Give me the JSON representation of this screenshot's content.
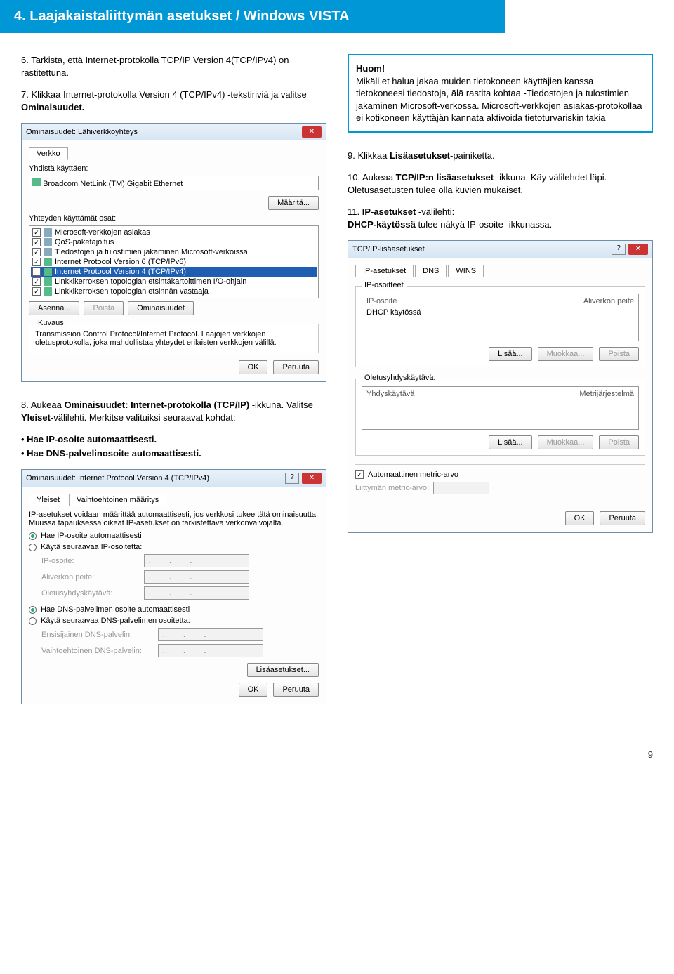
{
  "section_title": "4. Laajakaistaliittymän asetukset / Windows VISTA",
  "page_number": "9",
  "left": {
    "step6": {
      "text": "6. Tarkista, että Internet-protokolla TCP/IP Version 4(TCP/IPv4) on rastitettuna."
    },
    "step7": {
      "text_a": "7. Klikkaa Internet-protokolla Version 4 (TCP/IPv4) -tekstiriviä  ja valitse ",
      "text_b": "Ominaisuudet."
    },
    "win1": {
      "title": "Ominaisuudet: Lähiverkkoyhteys",
      "tab": "Verkko",
      "connect_using_label": "Yhdistä käyttäen:",
      "adapter": "Broadcom NetLink (TM) Gigabit Ethernet",
      "btn_maaritä": "Määritä...",
      "items_label": "Yhteyden käyttämät osat:",
      "items": [
        {
          "label": "Microsoft-verkkojen asiakas",
          "checked": true
        },
        {
          "label": "QoS-paketajoitus",
          "checked": true
        },
        {
          "label": "Tiedostojen ja tulostimien jakaminen Microsoft-verkoissa",
          "checked": true
        },
        {
          "label": "Internet Protocol Version 6 (TCP/IPv6)",
          "checked": true
        },
        {
          "label": "Internet Protocol Version 4 (TCP/IPv4)",
          "checked": true,
          "selected": true
        },
        {
          "label": "Linkkikerroksen topologian etsintäkartoittimen I/O-ohjain",
          "checked": true
        },
        {
          "label": "Linkkikerroksen topologian etsinnän vastaaja",
          "checked": true
        }
      ],
      "btn_asenna": "Asenna...",
      "btn_poista": "Poista",
      "btn_ominaisuudet": "Ominaisuudet",
      "desc_label": "Kuvaus",
      "desc_text": "Transmission Control Protocol/Internet Protocol. Laajojen verkkojen oletusprotokolla, joka mahdollistaa yhteydet erilaisten verkkojen välillä.",
      "ok": "OK",
      "cancel": "Peruuta"
    },
    "step8": {
      "text_a": "8. Aukeaa ",
      "text_b": "Ominaisuudet: Internet-protokolla (TCP/IP)",
      "text_c": " -ikkuna. Valitse ",
      "text_d": "Yleiset",
      "text_e": "-välilehti. Merkitse valituiksi seuraavat kohdat:",
      "bul1": "Hae IP-osoite automaattisesti.",
      "bul2": "Hae DNS-palvelinosoite automaattisesti."
    },
    "win2": {
      "title": "Ominaisuudet: Internet Protocol Version 4 (TCP/IPv4)",
      "tab_general": "Yleiset",
      "tab_alt": "Vaihtoehtoinen määritys",
      "intro": "IP-asetukset voidaan määrittää automaattisesti, jos verkkosi tukee tätä ominaisuutta. Muussa tapauksessa oikeat IP-asetukset on tarkistettava verkonvalvojalta.",
      "r1": "Hae IP-osoite automaattisesti",
      "r2": "Käytä seuraavaa IP-osoitetta:",
      "f_ip": "IP-osoite:",
      "f_mask": "Aliverkon peite:",
      "f_gw": "Oletusyhdyskäytävä:",
      "r3": "Hae DNS-palvelimen osoite automaattisesti",
      "r4": "Käytä seuraavaa DNS-palvelimen osoitetta:",
      "f_dns1": "Ensisijainen DNS-palvelin:",
      "f_dns2": "Vaihtoehtoinen DNS-palvelin:",
      "btn_adv": "Lisäasetukset...",
      "ok": "OK",
      "cancel": "Peruuta"
    }
  },
  "right": {
    "notice": {
      "head": "Huom!",
      "body": "Mikäli et halua jakaa muiden tietokoneen käyttäjien kanssa tietokoneesi tiedostoja, älä rastita kohtaa -Tiedostojen ja tulostimien jakaminen Microsoft-verkossa. Microsoft-verkkojen asiakas-protokollaa ei kotikoneen käyttäjän kannata aktivoida tietoturvariskin takia"
    },
    "step9": {
      "a": "9. Klikkaa ",
      "b": "Lisäasetukset",
      "c": "-painiketta."
    },
    "step10": {
      "a": "10. Aukeaa ",
      "b": "TCP/IP:n lisäasetukset",
      "c": " -ikkuna. Käy välilehdet läpi. Oletusasetusten tulee olla kuvien mukaiset."
    },
    "step11": {
      "a": "11. ",
      "b": "IP-asetukset ",
      "c": "-välilehti:",
      "d": "DHCP-käytössä ",
      "e": "tulee näkyä IP-osoite -ikkunassa."
    },
    "win3": {
      "title": "TCP/IP-lisäasetukset",
      "tabs": [
        "IP-asetukset",
        "DNS",
        "WINS"
      ],
      "grp1_title": "IP-osoitteet",
      "grp1_hdr_a": "IP-osoite",
      "grp1_hdr_b": "Aliverkon peite",
      "grp1_val": "DHCP käytössä",
      "btn_add": "Lisää...",
      "btn_edit": "Muokkaa...",
      "btn_del": "Poista",
      "grp2_title": "Oletusyhdyskäytävä:",
      "grp2_hdr_a": "Yhdyskäytävä",
      "grp2_hdr_b": "Metrijärjestelmä",
      "chk_metric": "Automaattinen metric-arvo",
      "lbl_metric": "Liittymän metric-arvo:",
      "ok": "OK",
      "cancel": "Peruuta"
    }
  }
}
